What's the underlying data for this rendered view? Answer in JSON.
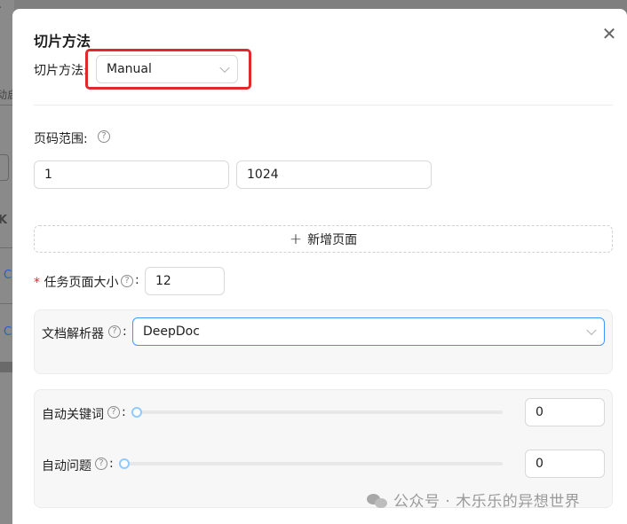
{
  "backdrop": {
    "fragment_top": "·",
    "fragment_mid": "动启",
    "fragment_k": "K",
    "fragment_c1": "C",
    "fragment_c2": "C"
  },
  "modal": {
    "title": "切片方法",
    "close_glyph": "✕",
    "chunk_method": {
      "label": "切片方法:",
      "value": "Manual"
    },
    "page_range": {
      "label": "页码范围:",
      "from": "1",
      "to": "1024"
    },
    "add_page_button": {
      "icon": "plus-icon",
      "label": "新增页面"
    },
    "task_page_size": {
      "required_mark": "*",
      "label": "任务页面大小",
      "colon": ":",
      "value": "12"
    },
    "parser": {
      "label": "文档解析器",
      "colon": ":",
      "value": "DeepDoc"
    },
    "auto_keywords": {
      "label": "自动关键词",
      "colon": ":",
      "value": "0",
      "slider_level": 0
    },
    "auto_questions": {
      "label": "自动问题",
      "colon": ":",
      "value": "0",
      "slider_level": 0
    },
    "help_glyph": "?"
  },
  "watermark": {
    "text": "公众号 · 木乐乐的异想世界",
    "icon": "wechat-icon"
  },
  "colors": {
    "highlight": "#e0282d",
    "slider_handle": "#91caff",
    "panel_bg": "#f7f7f7"
  }
}
